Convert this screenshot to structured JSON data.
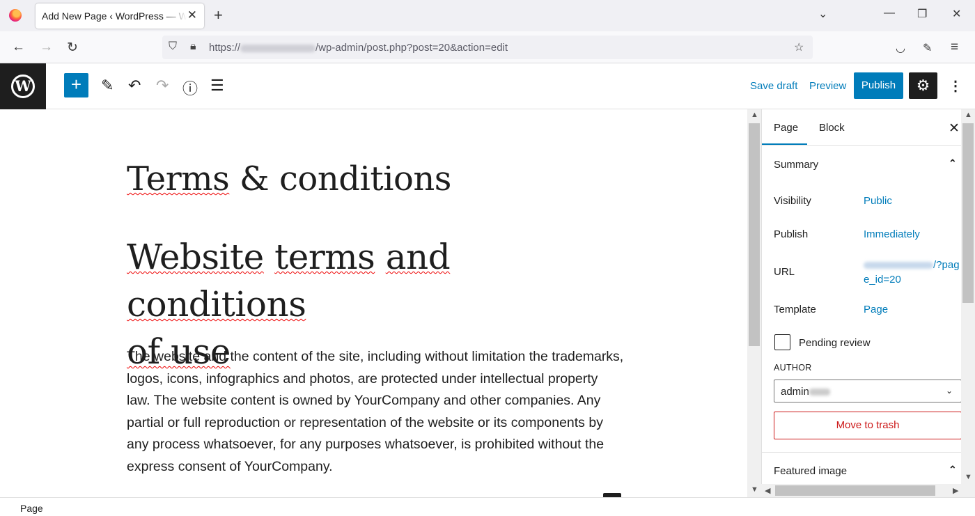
{
  "browser": {
    "tab_title": "Add New Page ‹ WordPress — WordPress",
    "url_prefix": "https://",
    "url_path": "/wp-admin/post.php?post=20&action=edit"
  },
  "header": {
    "save_draft": "Save draft",
    "preview": "Preview",
    "publish": "Publish"
  },
  "editor": {
    "title": "Terms & conditions",
    "heading": "Website terms and conditions of use",
    "paragraph": "The website and the content of the site, including without limitation the trademarks, logos, icons, infographics and photos, are protected under intellectual property law. The website content is owned by YourCompany and other companies. Any partial or full reproduction or representation of the website or its components by any process whatsoever, for any purposes whatsoever, is prohibited without the express consent of YourCompany."
  },
  "sidebar": {
    "tabs": [
      "Page",
      "Block"
    ],
    "summary": "Summary",
    "visibility_label": "Visibility",
    "visibility_value": "Public",
    "publish_label": "Publish",
    "publish_value": "Immediately",
    "url_label": "URL",
    "url_value": "/?page_id=20",
    "template_label": "Template",
    "template_value": "Page",
    "pending_review": "Pending review",
    "author_label": "AUTHOR",
    "author_value": "admin",
    "move_to_trash": "Move to trash",
    "featured_image": "Featured image"
  },
  "footer": {
    "breadcrumb": "Page"
  },
  "colors": {
    "accent": "#007cba",
    "danger": "#cc1818",
    "dark": "#1e1e1e"
  }
}
